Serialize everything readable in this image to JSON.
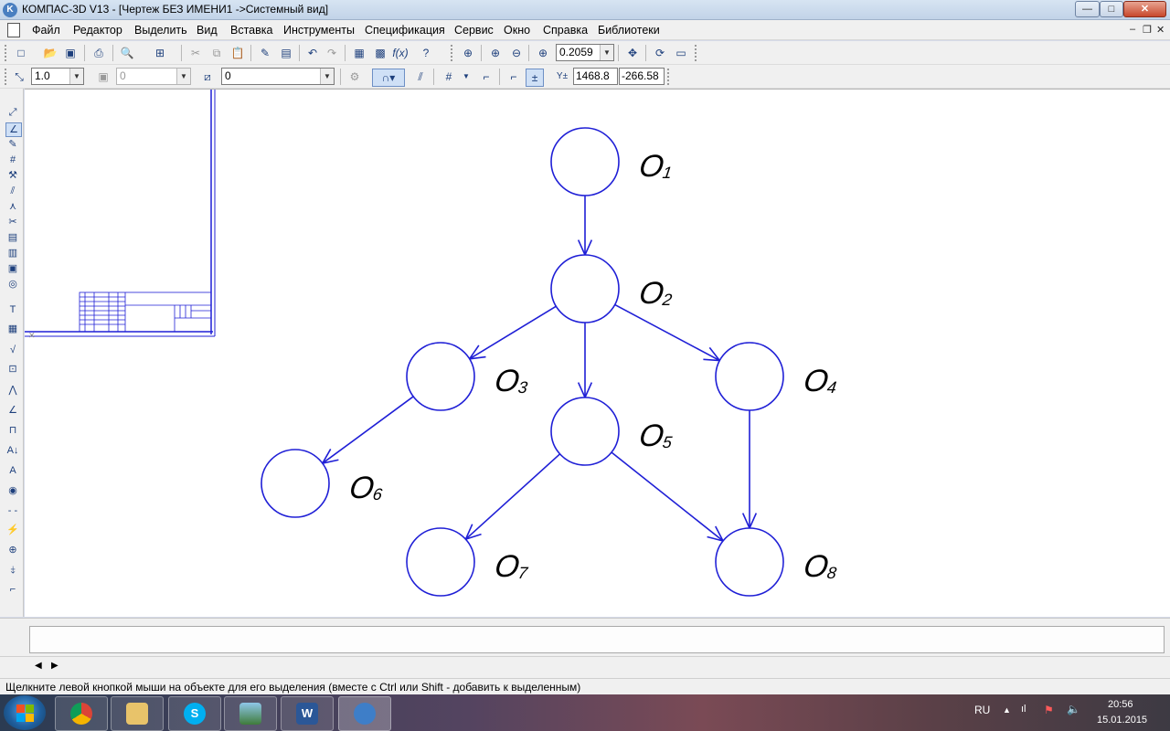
{
  "window": {
    "title": "КОМПАС-3D V13 - [Чертеж БЕЗ ИМЕНИ1 ->Системный вид]",
    "app_icon": "kompas-logo-icon",
    "buttons": {
      "minimize": "—",
      "maximize": "□",
      "close": "✕"
    }
  },
  "menu": {
    "items": [
      "Файл",
      "Редактор",
      "Выделить",
      "Вид",
      "Вставка",
      "Инструменты",
      "Спецификация",
      "Сервис",
      "Окно",
      "Справка",
      "Библиотеки"
    ],
    "mdi": {
      "minimize": "–",
      "restore": "❐",
      "close": "✕"
    }
  },
  "toolbar1": {
    "zoom_value": "0.2059"
  },
  "toolbar2": {
    "line_scale": "1.0",
    "layer_value": "0",
    "style_value": "0",
    "coord_x": "1468.8",
    "coord_y": "-266.58"
  },
  "graph": {
    "nodes": [
      {
        "id": "node-1",
        "label": "O",
        "sub": "1"
      },
      {
        "id": "node-2",
        "label": "O",
        "sub": "2"
      },
      {
        "id": "node-3",
        "label": "O",
        "sub": "3"
      },
      {
        "id": "node-4",
        "label": "O",
        "sub": "4"
      },
      {
        "id": "node-5",
        "label": "O",
        "sub": "5"
      },
      {
        "id": "node-6",
        "label": "O",
        "sub": "6"
      },
      {
        "id": "node-7",
        "label": "O",
        "sub": "7"
      },
      {
        "id": "node-8",
        "label": "O",
        "sub": "8"
      }
    ],
    "edges": [
      [
        "node-1",
        "node-2"
      ],
      [
        "node-2",
        "node-3"
      ],
      [
        "node-2",
        "node-5"
      ],
      [
        "node-2",
        "node-4"
      ],
      [
        "node-3",
        "node-6"
      ],
      [
        "node-5",
        "node-7"
      ],
      [
        "node-5",
        "node-8"
      ],
      [
        "node-4",
        "node-8"
      ]
    ],
    "color": "#1f1fd6"
  },
  "statusbar": {
    "hint": "Щелкните левой кнопкой мыши на объекте для его выделения (вместе с Ctrl или Shift - добавить к выделенным)"
  },
  "taskbar": {
    "apps": [
      "chrome",
      "explorer",
      "skype",
      "photo-viewer",
      "word",
      "kompas"
    ],
    "word_letter": "W",
    "skype_letter": "S",
    "language": "RU",
    "time": "20:56",
    "date": "15.01.2015"
  }
}
